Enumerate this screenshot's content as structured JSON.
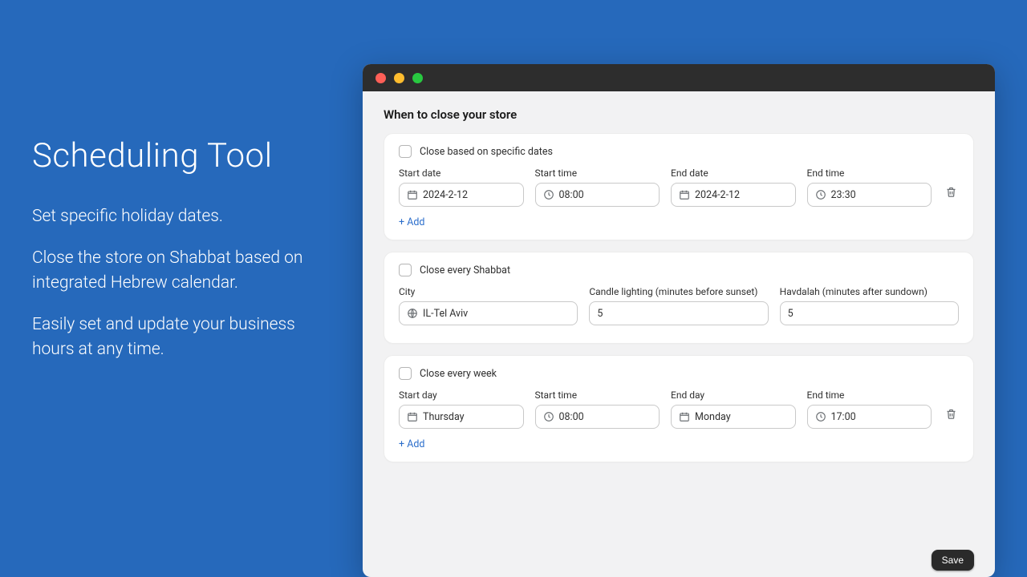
{
  "hero": {
    "title": "Scheduling Tool",
    "line1": "Set specific holiday dates.",
    "line2": "Close the store on Shabbat based on integrated Hebrew calendar.",
    "line3": "Easily set and update your business hours at any time."
  },
  "page_title": "When to close your store",
  "card1": {
    "checkbox_label": "Close based on specific dates",
    "start_date_label": "Start date",
    "start_date_value": "2024-2-12",
    "start_time_label": "Start time",
    "start_time_value": "08:00",
    "end_date_label": "End date",
    "end_date_value": "2024-2-12",
    "end_time_label": "End time",
    "end_time_value": "23:30",
    "add_label": "+ Add"
  },
  "card2": {
    "checkbox_label": "Close every Shabbat",
    "city_label": "City",
    "city_value": "IL-Tel Aviv",
    "candle_label": "Candle lighting (minutes before sunset)",
    "candle_value": "5",
    "havdalah_label": "Havdalah (minutes after sundown)",
    "havdalah_value": "5"
  },
  "card3": {
    "checkbox_label": "Close every week",
    "start_day_label": "Start day",
    "start_day_value": "Thursday",
    "start_time_label": "Start time",
    "start_time_value": "08:00",
    "end_day_label": "End day",
    "end_day_value": "Monday",
    "end_time_label": "End time",
    "end_time_value": "17:00",
    "add_label": "+ Add"
  },
  "save_label": "Save"
}
